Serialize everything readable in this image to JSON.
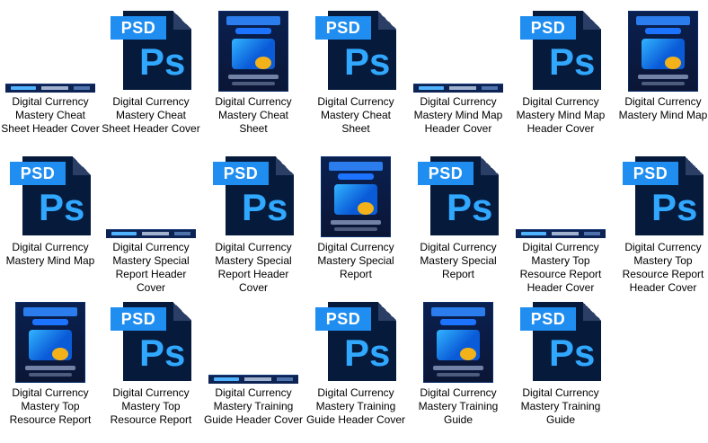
{
  "items": [
    {
      "type": "banner",
      "label": "Digital Currency Mastery Cheat Sheet Header Cover"
    },
    {
      "type": "psd",
      "label": "Digital Currency Mastery Cheat Sheet Header Cover",
      "tag": "PSD",
      "ps": "Ps"
    },
    {
      "type": "cover",
      "label": "Digital Currency Mastery Cheat Sheet"
    },
    {
      "type": "psd",
      "label": "Digital Currency Mastery Cheat Sheet",
      "tag": "PSD",
      "ps": "Ps"
    },
    {
      "type": "banner",
      "label": "Digital Currency Mastery Mind Map Header Cover"
    },
    {
      "type": "psd",
      "label": "Digital Currency Mastery Mind Map Header Cover",
      "tag": "PSD",
      "ps": "Ps"
    },
    {
      "type": "cover",
      "label": "Digital Currency Mastery Mind Map"
    },
    {
      "type": "psd",
      "label": "Digital Currency Mastery Mind Map",
      "tag": "PSD",
      "ps": "Ps"
    },
    {
      "type": "banner",
      "label": "Digital Currency Mastery Special Report Header Cover"
    },
    {
      "type": "psd",
      "label": "Digital Currency Mastery Special Report Header Cover",
      "tag": "PSD",
      "ps": "Ps"
    },
    {
      "type": "cover",
      "label": "Digital Currency Mastery Special Report"
    },
    {
      "type": "psd",
      "label": "Digital Currency Mastery Special Report",
      "tag": "PSD",
      "ps": "Ps"
    },
    {
      "type": "banner",
      "label": "Digital Currency Mastery Top Resource Report Header Cover"
    },
    {
      "type": "psd",
      "label": "Digital Currency Mastery Top Resource Report Header Cover",
      "tag": "PSD",
      "ps": "Ps"
    },
    {
      "type": "cover",
      "label": "Digital Currency Mastery Top Resource Report"
    },
    {
      "type": "psd",
      "label": "Digital Currency Mastery Top Resource Report",
      "tag": "PSD",
      "ps": "Ps"
    },
    {
      "type": "banner",
      "label": "Digital Currency Mastery Training Guide Header Cover"
    },
    {
      "type": "psd",
      "label": "Digital Currency Mastery Training Guide Header Cover",
      "tag": "PSD",
      "ps": "Ps"
    },
    {
      "type": "cover",
      "label": "Digital Currency Mastery Training Guide"
    },
    {
      "type": "psd",
      "label": "Digital Currency Mastery Training Guide",
      "tag": "PSD",
      "ps": "Ps"
    }
  ]
}
